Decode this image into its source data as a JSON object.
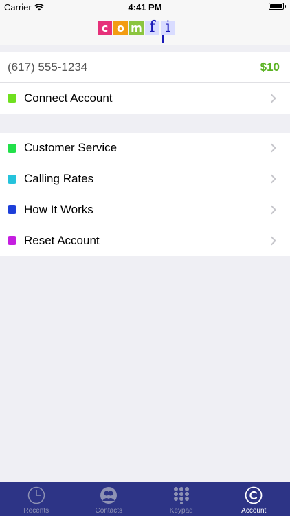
{
  "status_bar": {
    "carrier": "Carrier",
    "time": "4:41 PM"
  },
  "header": {
    "logo_letters": [
      "c",
      "o",
      "m",
      "f",
      "i"
    ],
    "logo_colors": [
      "#e6317a",
      "#f39c12",
      "#8bc53f",
      "#d9dcff",
      "#d9dcff"
    ]
  },
  "account": {
    "phone_number": "(617) 555-1234",
    "balance": "$10"
  },
  "group_1": [
    {
      "label": "Connect Account",
      "color": "#6fe01f"
    }
  ],
  "group_2": [
    {
      "label": "Customer Service",
      "color": "#22e04a"
    },
    {
      "label": "Calling Rates",
      "color": "#25c3dc"
    },
    {
      "label": "How It Works",
      "color": "#1d3fd9"
    },
    {
      "label": "Reset Account",
      "color": "#c51ee0"
    }
  ],
  "tabs": [
    {
      "label": "Recents",
      "icon": "clock-icon",
      "active": false
    },
    {
      "label": "Contacts",
      "icon": "contacts-icon",
      "active": false
    },
    {
      "label": "Keypad",
      "icon": "keypad-icon",
      "active": false
    },
    {
      "label": "Account",
      "icon": "account-c-icon",
      "active": true
    }
  ],
  "colors": {
    "tab_bar": "#2d3486",
    "balance": "#5bb323",
    "background": "#efeff4"
  }
}
